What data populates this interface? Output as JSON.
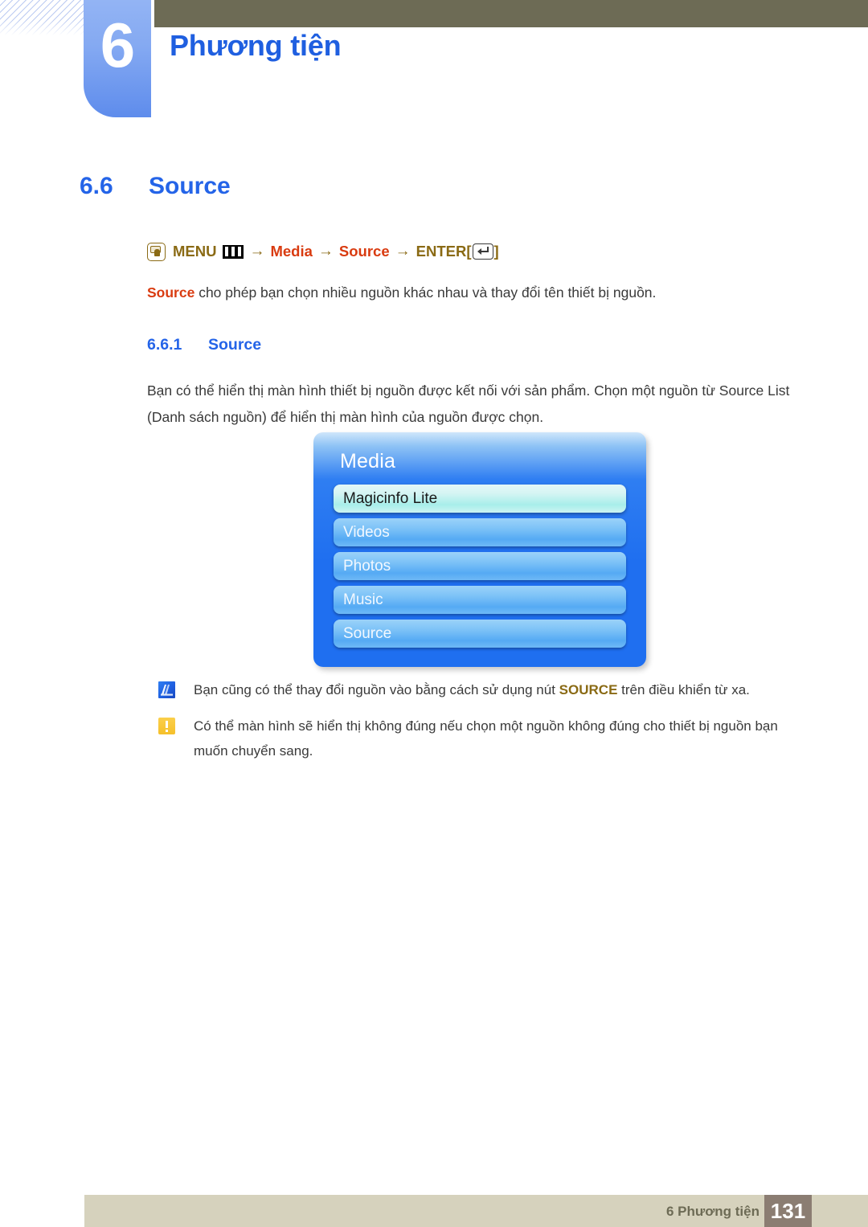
{
  "header": {
    "chapter_number": "6",
    "chapter_title": "Phương tiện",
    "accent_blue": "#1f5fe0",
    "olive": "#6d6b55"
  },
  "section": {
    "number": "6.6",
    "title": "Source"
  },
  "menu_path": {
    "press_icon": "press-button-icon",
    "menu_label": "MENU",
    "menu_icon": "menu-bars-icon",
    "arrow": "→",
    "step_media": "Media",
    "step_source": "Source",
    "enter_label": "ENTER",
    "enter_icon": "enter-key-icon",
    "bracket_open": "[",
    "bracket_close": "]",
    "label_color": "#8a6a14",
    "step_color": "#d93b10"
  },
  "intro": {
    "bold_lead": "Source",
    "rest": " cho phép bạn chọn nhiều nguồn khác nhau và thay đổi tên thiết bị nguồn."
  },
  "subsection": {
    "number": "6.6.1",
    "title": "Source"
  },
  "paragraph": "Bạn có thể hiển thị màn hình thiết bị nguồn được kết nối với sản phẩm. Chọn một nguồn từ Source List (Danh sách nguồn) để hiển thị màn hình của nguồn được chọn.",
  "osd": {
    "title": "Media",
    "items": [
      {
        "label": "Magicinfo Lite",
        "selected": true
      },
      {
        "label": "Videos",
        "selected": false
      },
      {
        "label": "Photos",
        "selected": false
      },
      {
        "label": "Music",
        "selected": false
      },
      {
        "label": "Source",
        "selected": false
      }
    ]
  },
  "notes": [
    {
      "icon": "note-pencil-icon",
      "pre": "Bạn cũng có thể thay đổi nguồn vào bằng cách sử dụng nút ",
      "bold": "SOURCE",
      "post": " trên điều khiển từ xa."
    },
    {
      "icon": "caution-exclamation-icon",
      "pre": "Có thể màn hình sẽ hiển thị không đúng nếu chọn một nguồn không đúng cho thiết bị nguồn bạn muốn chuyển sang.",
      "bold": "",
      "post": ""
    }
  ],
  "footer": {
    "label": "6 Phương tiện",
    "page_number": "131"
  }
}
